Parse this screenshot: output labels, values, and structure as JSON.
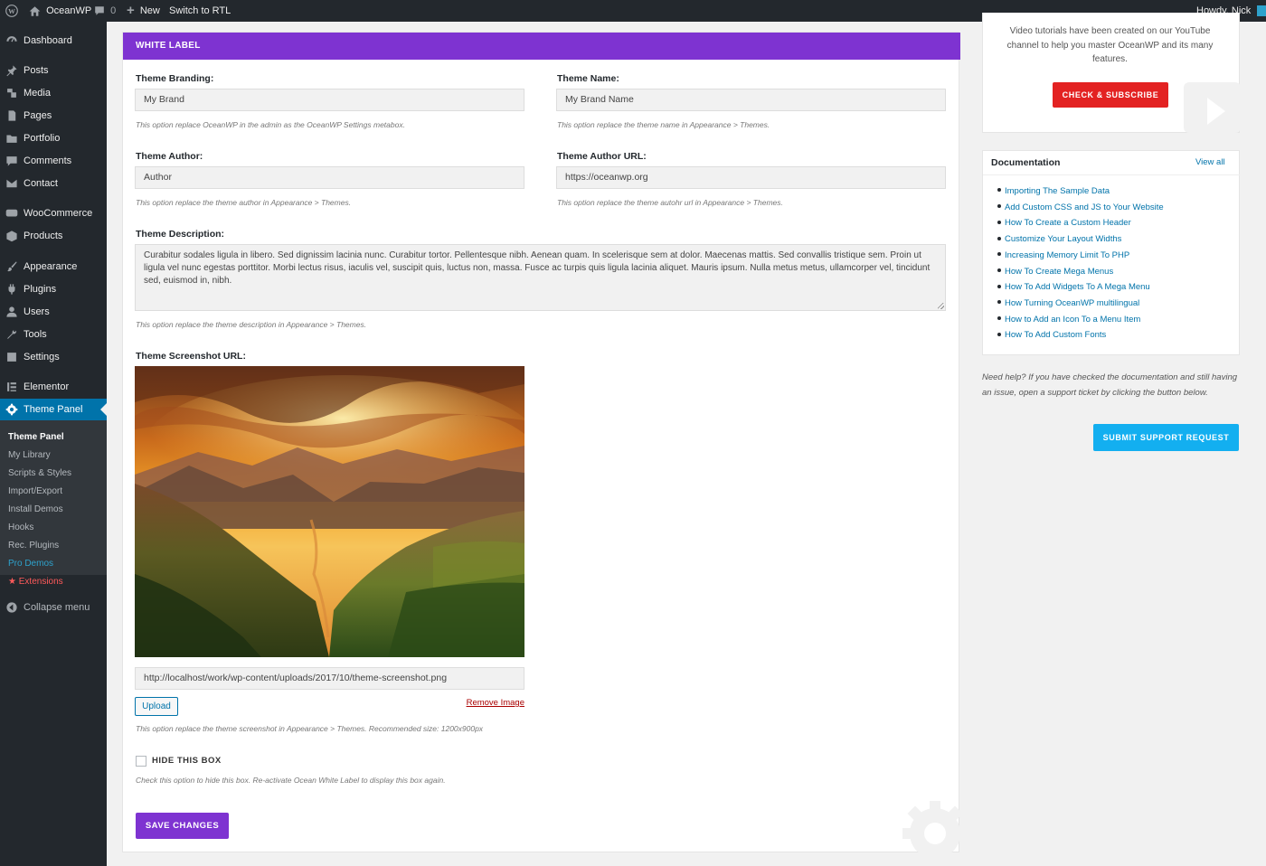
{
  "admin_bar": {
    "site_name": "OceanWP",
    "comments_count": "0",
    "new_label": "New",
    "rtl_label": "Switch to RTL",
    "greeting": "Howdy, Nick"
  },
  "sidebar": {
    "items": [
      {
        "label": "Dashboard",
        "icon": "dashboard-icon"
      },
      {
        "label": "Posts",
        "icon": "pin-icon"
      },
      {
        "label": "Media",
        "icon": "media-icon"
      },
      {
        "label": "Pages",
        "icon": "pages-icon"
      },
      {
        "label": "Portfolio",
        "icon": "folder-icon"
      },
      {
        "label": "Comments",
        "icon": "comment-icon"
      },
      {
        "label": "Contact",
        "icon": "mail-icon"
      },
      {
        "label": "WooCommerce",
        "icon": "woo-icon"
      },
      {
        "label": "Products",
        "icon": "box-icon"
      },
      {
        "label": "Appearance",
        "icon": "brush-icon"
      },
      {
        "label": "Plugins",
        "icon": "plug-icon"
      },
      {
        "label": "Users",
        "icon": "user-icon"
      },
      {
        "label": "Tools",
        "icon": "wrench-icon"
      },
      {
        "label": "Settings",
        "icon": "settings-icon"
      },
      {
        "label": "Elementor",
        "icon": "elementor-icon"
      },
      {
        "label": "Theme Panel",
        "icon": "gear-icon"
      }
    ],
    "submenu": [
      "Theme Panel",
      "My Library",
      "Scripts & Styles",
      "Import/Export",
      "Install Demos",
      "Hooks",
      "Rec. Plugins",
      "Pro Demos",
      "Extensions"
    ],
    "collapse_label": "Collapse menu"
  },
  "panel": {
    "header": "WHITE LABEL",
    "branding": {
      "label": "Theme Branding:",
      "value": "My Brand",
      "desc": "This option replace OceanWP in the admin as the OceanWP Settings metabox."
    },
    "name": {
      "label": "Theme Name:",
      "value": "My Brand Name",
      "desc": "This option replace the theme name in Appearance > Themes."
    },
    "author": {
      "label": "Theme Author:",
      "value": "Author",
      "desc": "This option replace the theme author in Appearance > Themes."
    },
    "author_url": {
      "label": "Theme Author URL:",
      "value": "https://oceanwp.org",
      "desc": "This option replace the theme autohr url in Appearance > Themes."
    },
    "description": {
      "label": "Theme Description:",
      "value": "Curabitur sodales ligula in libero. Sed dignissim lacinia nunc. Curabitur tortor. Pellentesque nibh. Aenean quam. In scelerisque sem at dolor. Maecenas mattis. Sed convallis tristique sem. Proin ut ligula vel nunc egestas porttitor. Morbi lectus risus, iaculis vel, suscipit quis, luctus non, massa. Fusce ac turpis quis ligula lacinia aliquet. Mauris ipsum. Nulla metus metus, ullamcorper vel, tincidunt sed, euismod in, nibh.",
      "desc": "This option replace the theme description in Appearance > Themes."
    },
    "screenshot": {
      "label": "Theme Screenshot URL:",
      "url": "http://localhost/work/wp-content/uploads/2017/10/theme-screenshot.png",
      "upload_label": "Upload",
      "remove_label": "Remove Image",
      "desc": "This option replace the theme screenshot in Appearance > Themes. Recommended size: 1200x900px"
    },
    "hide_box": {
      "label": "HIDE THIS BOX",
      "checked": false,
      "desc": "Check this option to hide this box. Re-activate Ocean White Label to display this box again."
    },
    "save_label": "SAVE CHANGES"
  },
  "right": {
    "youtube_text": "Video tutorials have been created on our YouTube channel to help you master OceanWP and its many features.",
    "youtube_btn": "CHECK & SUBSCRIBE",
    "docs_title": "Documentation",
    "docs_viewall": "View all",
    "docs": [
      "Importing The Sample Data",
      "Add Custom CSS and JS to Your Website",
      "How To Create a Custom Header",
      "Customize Your Layout Widths",
      "Increasing Memory Limit To PHP",
      "How To Create Mega Menus",
      "How To Add Widgets To A Mega Menu",
      "How Turning OceanWP multilingual",
      "How to Add an Icon To a Menu Item",
      "How To Add Custom Fonts"
    ],
    "help_text": "Need help? If you have checked the documentation and still having an issue, open a support ticket by clicking the button below.",
    "support_btn": "SUBMIT SUPPORT REQUEST"
  },
  "colors": {
    "accent": "#7e33d1",
    "wp_blue": "#0073aa",
    "sidebar_bg": "#23282d",
    "youtube_red": "#e32222",
    "support_blue": "#13aff0"
  }
}
